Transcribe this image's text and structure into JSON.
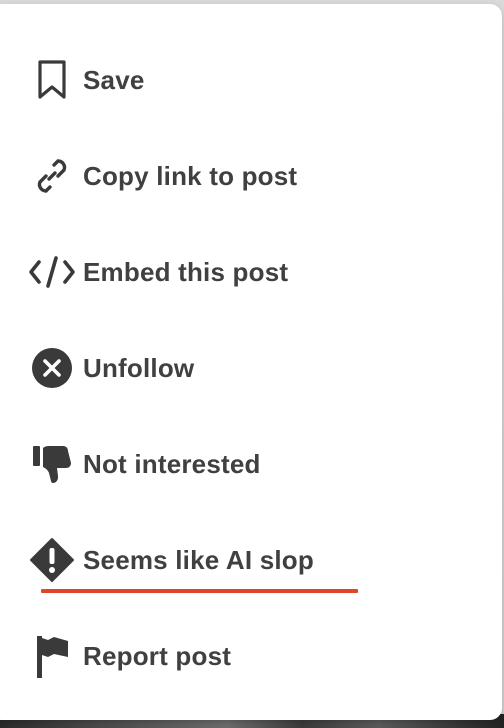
{
  "menu": {
    "items": [
      {
        "label": "Save",
        "icon": "bookmark-icon"
      },
      {
        "label": "Copy link to post",
        "icon": "link-icon"
      },
      {
        "label": "Embed this post",
        "icon": "code-icon"
      },
      {
        "label": "Unfollow",
        "icon": "x-circle-icon"
      },
      {
        "label": "Not interested",
        "icon": "thumbs-down-icon"
      },
      {
        "label": "Seems like AI slop",
        "icon": "warning-diamond-icon"
      },
      {
        "label": "Report post",
        "icon": "flag-icon"
      }
    ]
  },
  "colors": {
    "text": "#404040",
    "icon": "#3a3a3a",
    "highlight_underline": "#e0452a",
    "menu_background": "#ffffff"
  }
}
